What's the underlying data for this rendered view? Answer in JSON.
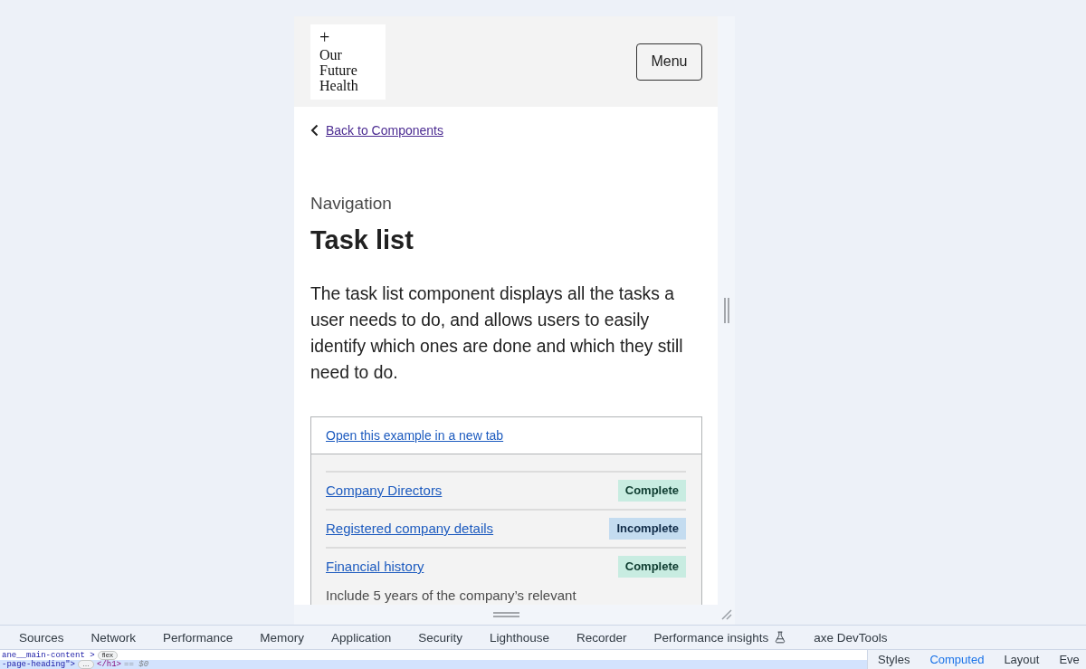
{
  "page": {
    "header": {
      "logo": {
        "symbol": "+",
        "wordmark": "Our Future Health"
      },
      "menu_button": "Menu"
    },
    "back_link": "Back to Components",
    "caption": "Navigation",
    "title": "Task list",
    "intro": "The task list component displays all the tasks a user needs to do, and allows users to easily identify which ones are done and which they still need to do.",
    "example": {
      "open_link": "Open this example in a new tab",
      "tasks": [
        {
          "name": "Company Directors",
          "status": {
            "label": "Complete",
            "kind": "complete"
          }
        },
        {
          "name": "Registered company details",
          "status": {
            "label": "Incomplete",
            "kind": "incomplete"
          }
        },
        {
          "name": "Financial history",
          "status": {
            "label": "Complete",
            "kind": "complete"
          },
          "hint": "Include 5 years of the company’s relevant"
        }
      ]
    }
  },
  "devtools": {
    "tabs": [
      {
        "label": "Sources",
        "kind": "plain",
        "selected": false
      },
      {
        "label": "Network",
        "kind": "plain",
        "selected": false
      },
      {
        "label": "Performance",
        "kind": "plain",
        "selected": false
      },
      {
        "label": "Memory",
        "kind": "plain",
        "selected": false
      },
      {
        "label": "Application",
        "kind": "plain",
        "selected": false
      },
      {
        "label": "Security",
        "kind": "plain",
        "selected": false
      },
      {
        "label": "Lighthouse",
        "kind": "plain",
        "selected": false
      },
      {
        "label": "Recorder",
        "kind": "plain",
        "selected": false
      },
      {
        "label": "Performance insights",
        "kind": "experimental",
        "selected": false
      },
      {
        "label": "axe DevTools",
        "kind": "plain",
        "selected": false
      }
    ],
    "elements_lines": [
      {
        "text": "ane__main-content >",
        "badge": "flex",
        "highlighted": false
      },
      {
        "text": "-page-heading\">",
        "badge": "…",
        "tail": "</h1>",
        "suffix": "== $0",
        "highlighted": true
      }
    ],
    "side_tabs": [
      {
        "label": "Styles",
        "selected": false
      },
      {
        "label": "Computed",
        "selected": true
      },
      {
        "label": "Layout",
        "selected": false
      },
      {
        "label": "Eve",
        "selected": false
      }
    ]
  }
}
